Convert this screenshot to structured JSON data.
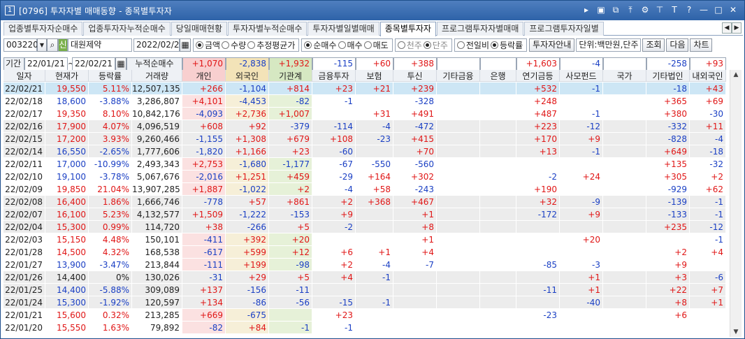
{
  "window": {
    "num": "1",
    "title": "[0796] 투자자별 매매동향 - 종목별투자자"
  },
  "tabs": [
    "업종별투자자순매수",
    "업종투자자누적순매수",
    "당일매매현황",
    "투자자별누적순매수",
    "투자자별일별매매",
    "종목별투자자",
    "프로그램투자자별매매",
    "프로그램투자자일별"
  ],
  "active_tab": 5,
  "toolbar": {
    "code": "003220",
    "sin": "신",
    "name": "대원제약",
    "date": "2022/02/21",
    "g1": [
      "금액",
      "수량",
      "추정평균가"
    ],
    "g1_sel": 0,
    "g2": [
      "순매수",
      "매수",
      "매도"
    ],
    "g2_sel": 0,
    "g3": [
      "천주",
      "단주"
    ],
    "g3_sel": 1,
    "g4": [
      "전일비",
      "등락률"
    ],
    "g4_sel": 1,
    "guide": "투자자안내",
    "unit": "단위:백만원,단주",
    "b_query": "조회",
    "b_next": "다음",
    "b_chart": "차트"
  },
  "sumbar": {
    "label_period": "기간",
    "from": "22/01/21",
    "to": "22/02/21",
    "label_cum": "누적순매수",
    "values": [
      "+1,070",
      "-2,838",
      "+1,932",
      "-115",
      "+60",
      "+388",
      "",
      "",
      "+1,603",
      "-4",
      "",
      "-258",
      "+93"
    ]
  },
  "columns": [
    "일자",
    "현재가",
    "등락률",
    "거래량",
    "개인",
    "외국인",
    "기관계",
    "금융투자",
    "보험",
    "투신",
    "기타금융",
    "은행",
    "연기금등",
    "사모펀드",
    "국가",
    "기타법인",
    "내외국인"
  ],
  "rows": [
    [
      "22/02/21",
      "19,550",
      "5.11%",
      "12,507,135",
      "+266",
      "-1,104",
      "+814",
      "+23",
      "+21",
      "+239",
      "",
      "",
      "+532",
      "-1",
      "",
      "-18",
      "+43"
    ],
    [
      "22/02/18",
      "18,600",
      "-3.88%",
      "3,286,807",
      "+4,101",
      "-4,453",
      "-82",
      "-1",
      "",
      "-328",
      "",
      "",
      "+248",
      "",
      "",
      "+365",
      "+69"
    ],
    [
      "22/02/17",
      "19,350",
      "8.10%",
      "10,842,176",
      "-4,093",
      "+2,736",
      "+1,007",
      "",
      "+31",
      "+491",
      "",
      "",
      "+487",
      "-1",
      "",
      "+380",
      "-30"
    ],
    [
      "22/02/16",
      "17,900",
      "4.07%",
      "4,096,519",
      "+608",
      "+92",
      "-379",
      "-114",
      "-4",
      "-472",
      "",
      "",
      "+223",
      "-12",
      "",
      "-332",
      "+11"
    ],
    [
      "22/02/15",
      "17,200",
      "3.93%",
      "9,260,466",
      "-1,155",
      "+1,308",
      "+679",
      "+108",
      "-23",
      "+415",
      "",
      "",
      "+170",
      "+9",
      "",
      "-828",
      "-4"
    ],
    [
      "22/02/14",
      "16,550",
      "-2.65%",
      "1,777,606",
      "-1,820",
      "+1,166",
      "+23",
      "-60",
      "",
      "+70",
      "",
      "",
      "+13",
      "-1",
      "",
      "+649",
      "-18"
    ],
    [
      "22/02/11",
      "17,000",
      "-10.99%",
      "2,493,343",
      "+2,753",
      "-1,680",
      "-1,177",
      "-67",
      "-550",
      "-560",
      "",
      "",
      "",
      "",
      "",
      "+135",
      "-32"
    ],
    [
      "22/02/10",
      "19,100",
      "-3.78%",
      "5,067,676",
      "-2,016",
      "+1,251",
      "+459",
      "-29",
      "+164",
      "+302",
      "",
      "",
      "-2",
      "+24",
      "",
      "+305",
      "+2"
    ],
    [
      "22/02/09",
      "19,850",
      "21.04%",
      "13,907,285",
      "+1,887",
      "-1,022",
      "+2",
      "-4",
      "+58",
      "-243",
      "",
      "",
      "+190",
      "",
      "",
      "-929",
      "+62"
    ],
    [
      "22/02/08",
      "16,400",
      "1.86%",
      "1,666,746",
      "-778",
      "+57",
      "+861",
      "+2",
      "+368",
      "+467",
      "",
      "",
      "+32",
      "-9",
      "",
      "-139",
      "-1"
    ],
    [
      "22/02/07",
      "16,100",
      "5.23%",
      "4,132,577",
      "+1,509",
      "-1,222",
      "-153",
      "+9",
      "",
      "+1",
      "",
      "",
      "-172",
      "+9",
      "",
      "-133",
      "-1"
    ],
    [
      "22/02/04",
      "15,300",
      "0.99%",
      "114,720",
      "+38",
      "-266",
      "+5",
      "-2",
      "",
      "+8",
      "",
      "",
      "",
      "",
      "",
      "+235",
      "-12"
    ],
    [
      "22/02/03",
      "15,150",
      "4.48%",
      "150,101",
      "-411",
      "+392",
      "+20",
      "",
      "",
      "+1",
      "",
      "",
      "",
      "+20",
      "",
      "",
      "-1"
    ],
    [
      "22/01/28",
      "14,500",
      "4.32%",
      "168,538",
      "-617",
      "+599",
      "+12",
      "+6",
      "+1",
      "+4",
      "",
      "",
      "",
      "",
      "",
      "+2",
      "+4"
    ],
    [
      "22/01/27",
      "13,900",
      "-3.47%",
      "213,844",
      "-111",
      "+199",
      "-98",
      "+2",
      "-4",
      "-7",
      "",
      "",
      "-85",
      "-3",
      "",
      "+9",
      ""
    ],
    [
      "22/01/26",
      "14,400",
      "0%",
      "130,026",
      "-31",
      "+29",
      "+5",
      "+4",
      "-1",
      "",
      "",
      "",
      "",
      "+1",
      "",
      "+3",
      "-6"
    ],
    [
      "22/01/25",
      "14,400",
      "-5.88%",
      "309,089",
      "+137",
      "-156",
      "-11",
      "",
      "",
      "",
      "",
      "",
      "-11",
      "+1",
      "",
      "+22",
      "+7"
    ],
    [
      "22/01/24",
      "15,300",
      "-1.92%",
      "120,597",
      "+134",
      "-86",
      "-56",
      "-15",
      "-1",
      "",
      "",
      "",
      "",
      "-40",
      "",
      "+8",
      "+1"
    ],
    [
      "22/01/21",
      "15,600",
      "0.32%",
      "213,285",
      "+669",
      "-675",
      "",
      "+23",
      "",
      "",
      "",
      "",
      "-23",
      "",
      "",
      "+6",
      ""
    ],
    [
      "22/01/20",
      "15,550",
      "1.63%",
      "79,892",
      "-82",
      "+84",
      "-1",
      "-1",
      "",
      "",
      "",
      "",
      "",
      "",
      "",
      "",
      ""
    ]
  ],
  "colors": {
    "up": "#e01616",
    "down": "#1a3fc4",
    "selected_row": "#cde6f5",
    "band": "#ececec",
    "indiv_bg": "#fbe1e1",
    "foreign_bg": "#f6efd8",
    "inst_bg": "#e6f1d8",
    "hdr_indiv": "#f8cfcf",
    "hdr_foreign": "#f3e3b8",
    "hdr_inst": "#d6e8c2"
  }
}
